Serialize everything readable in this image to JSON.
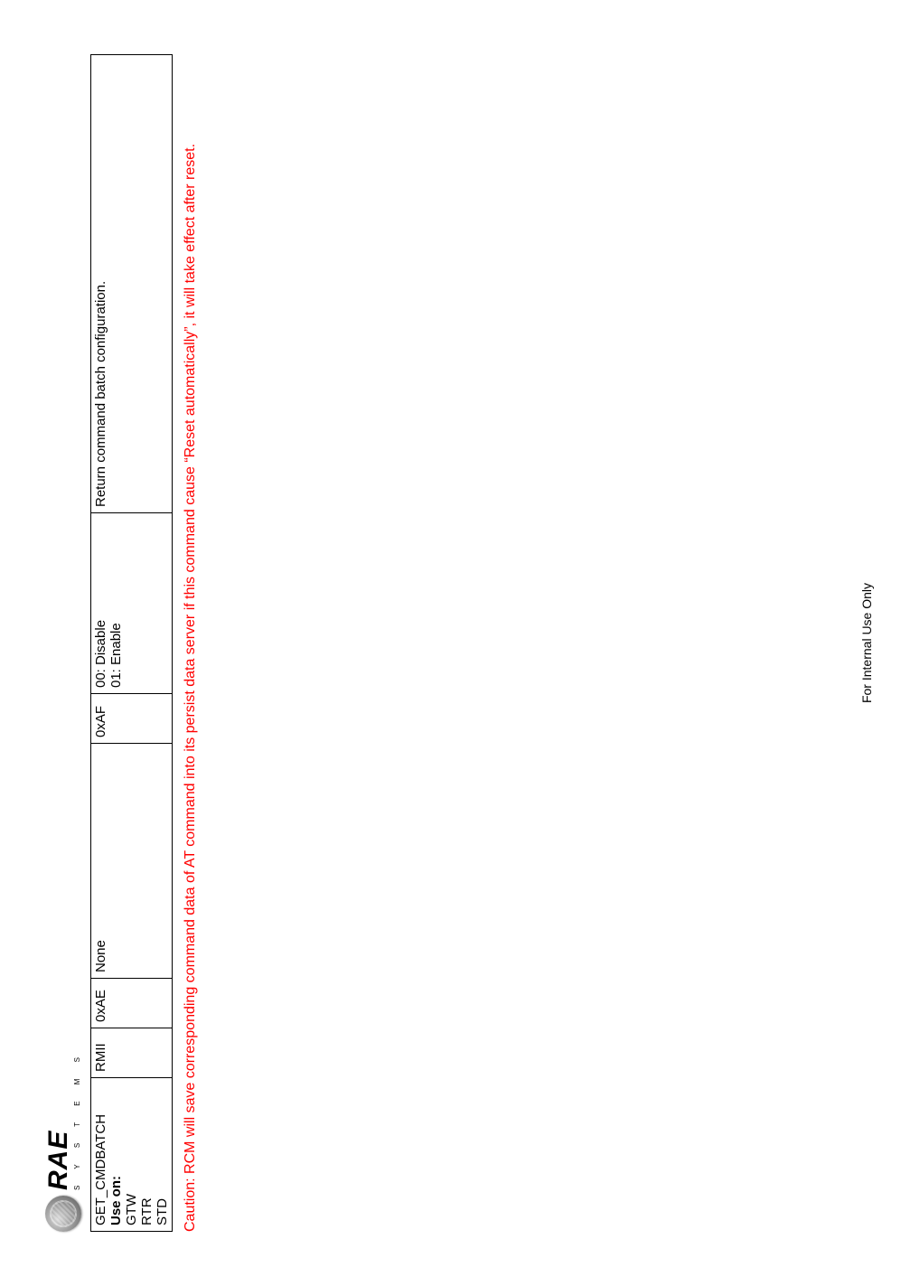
{
  "logo": {
    "brand": "RAE",
    "tagline": "S Y S T E M S"
  },
  "table": {
    "row": {
      "name_line1": "GET_CMDBATCH",
      "name_line2_label": "Use on:",
      "name_line3": "GTW",
      "name_line4": "RTR",
      "name_line5": "STD",
      "type": "RMII",
      "send_cmd": "0xAE",
      "send_param": "None",
      "return_cmd": "0xAF",
      "return_param_line1": "00: Disable",
      "return_param_line2": "01: Enable",
      "description": "Return command batch configuration."
    }
  },
  "caution": "Caution: RCM will save corresponding command data of AT command into its persist data server if this command cause “Reset automatically”, it will take effect after reset.",
  "footer": "For Internal Use Only"
}
